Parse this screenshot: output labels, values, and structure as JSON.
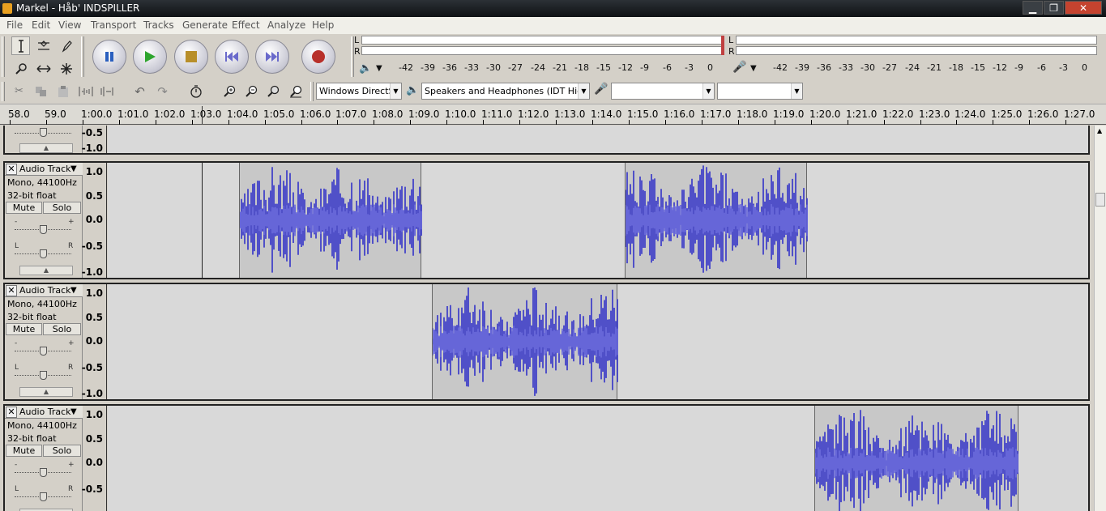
{
  "window": {
    "title": "Markel - Håb' INDSPILLER",
    "controls": [
      "▁",
      "❐",
      "✕"
    ]
  },
  "menu": [
    "File",
    "Edit",
    "View",
    "Transport",
    "Tracks",
    "Generate",
    "Effect",
    "Analyze",
    "Help"
  ],
  "tools": {
    "top": [
      "selection-tool-icon",
      "envelope-tool-icon",
      "draw-tool-icon"
    ],
    "bottom": [
      "zoom-tool-icon",
      "timeshift-tool-icon",
      "multi-tool-icon"
    ]
  },
  "transport": [
    "pause-icon",
    "play-icon",
    "stop-icon",
    "skip-start-icon",
    "skip-end-icon",
    "record-icon"
  ],
  "meter": {
    "play_channels": [
      "L",
      "R"
    ],
    "rec_channels": [
      "L",
      "R"
    ],
    "play_ticks": [
      "-42",
      "-39",
      "-36",
      "-33",
      "-30",
      "-27",
      "-24",
      "-21",
      "-18",
      "-15",
      "-12",
      "-9",
      "-6",
      "-3",
      "0"
    ],
    "rec_ticks": [
      "-42",
      "-39",
      "-36",
      "-33",
      "-30",
      "-27",
      "-24",
      "-21",
      "-18",
      "-15",
      "-12",
      "-9",
      "-6",
      "-3",
      "0"
    ]
  },
  "device": {
    "host": "Windows DirectSo",
    "output": "Speakers and Headphones (IDT High D",
    "input": "",
    "channels": ""
  },
  "ruler": {
    "labels": [
      "58.0",
      "59.0",
      "1:00.0",
      "1:01.0",
      "1:02.0",
      "1:03.0",
      "1:04.0",
      "1:05.0",
      "1:06.0",
      "1:07.0",
      "1:08.0",
      "1:09.0",
      "1:10.0",
      "1:11.0",
      "1:12.0",
      "1:13.0",
      "1:14.0",
      "1:15.0",
      "1:16.0",
      "1:17.0",
      "1:18.0",
      "1:19.0",
      "1:20.0",
      "1:21.0",
      "1:22.0",
      "1:23.0",
      "1:24.0",
      "1:25.0",
      "1:26.0",
      "1:27.0"
    ]
  },
  "track_labels": {
    "name": "Audio Track",
    "format": "Mono, 44100Hz",
    "bits": "32-bit float",
    "mute": "Mute",
    "solo": "Solo",
    "gain_minus": "-",
    "gain_plus": "+",
    "pan_l": "L",
    "pan_r": "R",
    "close": "✕"
  },
  "scale": [
    "1.0",
    "0.5",
    "0.0",
    "-0.5",
    "-1.0"
  ],
  "partial_scale": [
    "-0.5",
    "-1.0"
  ],
  "tracks": [
    {
      "clips": [
        {
          "start": "1:04.0",
          "end": "1:09.0"
        },
        {
          "start": "1:14.6",
          "end": "1:19.6"
        }
      ]
    },
    {
      "clips": [
        {
          "start": "1:09.3",
          "end": "1:14.4"
        }
      ]
    },
    {
      "clips": [
        {
          "start": "1:19.8",
          "end": "1:25.4"
        }
      ]
    }
  ]
}
